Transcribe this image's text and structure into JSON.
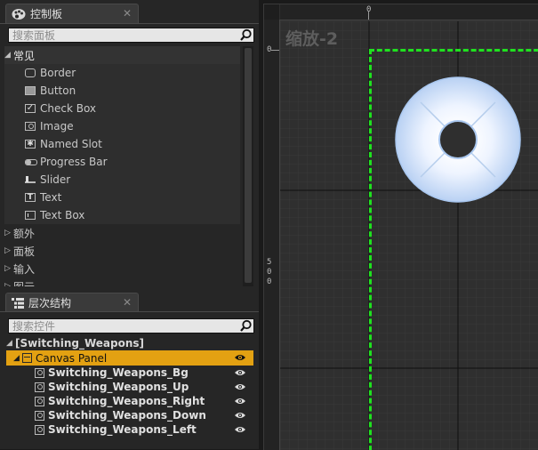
{
  "palette": {
    "tab_title": "控制板",
    "search_placeholder": "搜索面板",
    "categories": [
      {
        "label": "常见",
        "expanded": true
      },
      {
        "label": "额外",
        "expanded": false
      },
      {
        "label": "面板",
        "expanded": false
      },
      {
        "label": "输入",
        "expanded": false
      },
      {
        "label": "图元",
        "expanded": false
      }
    ],
    "widgets": [
      {
        "label": "Border",
        "icon": "border-icon"
      },
      {
        "label": "Button",
        "icon": "button-icon"
      },
      {
        "label": "Check Box",
        "icon": "checkbox-icon"
      },
      {
        "label": "Image",
        "icon": "image-icon"
      },
      {
        "label": "Named Slot",
        "icon": "named-slot-icon"
      },
      {
        "label": "Progress Bar",
        "icon": "progress-bar-icon"
      },
      {
        "label": "Slider",
        "icon": "slider-icon"
      },
      {
        "label": "Text",
        "icon": "text-icon"
      },
      {
        "label": "Text Box",
        "icon": "text-box-icon"
      }
    ]
  },
  "hierarchy": {
    "tab_title": "层次结构",
    "search_placeholder": "搜索控件",
    "root": "[Switching_Weapons]",
    "canvas_panel": "Canvas Panel",
    "children": [
      "Switching_Weapons_Bg",
      "Switching_Weapons_Up",
      "Switching_Weapons_Right",
      "Switching_Weapons_Down",
      "Switching_Weapons_Left"
    ]
  },
  "designer": {
    "zoom_label": "缩放-2",
    "ruler_top_0": "0",
    "ruler_left_0": "0",
    "ruler_left_500": [
      "5",
      "0",
      "0"
    ]
  },
  "colors": {
    "selection": "#e3a112",
    "canvas_outline": "#1fe21f",
    "wheel_light": "#f6faff",
    "wheel_edge": "#a9c7ef"
  }
}
